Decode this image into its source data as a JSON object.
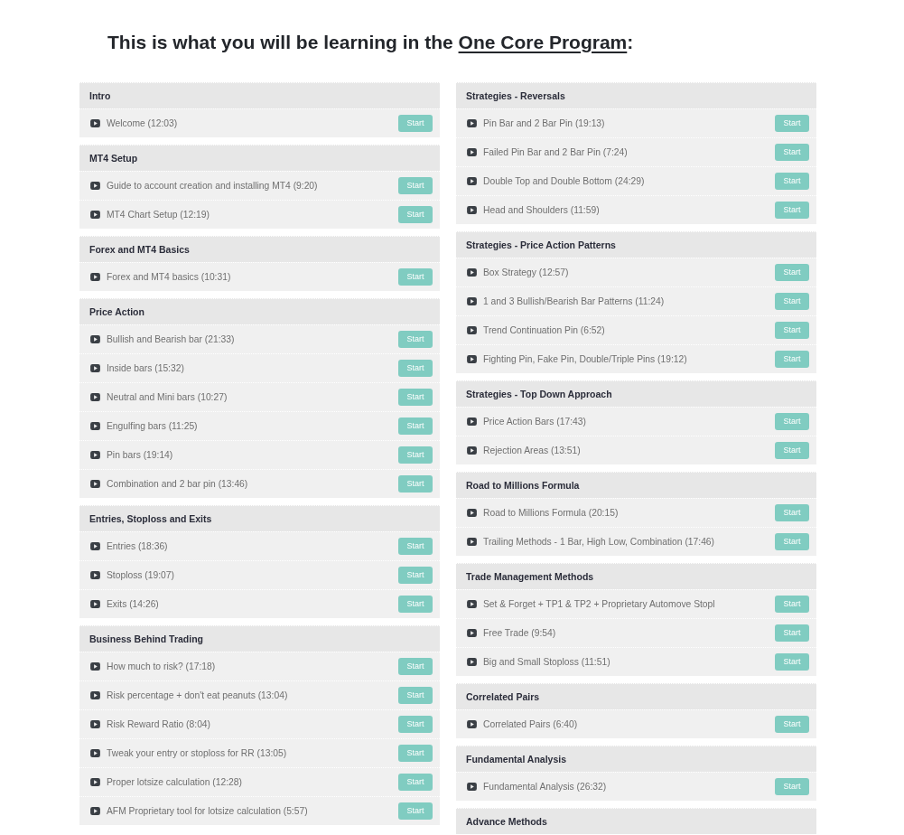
{
  "heading": {
    "text": "This is what you will be learning in the ",
    "link": "One Core Program",
    "suffix": ":"
  },
  "columns": [
    {
      "sections": [
        {
          "title": "Intro",
          "lessons": [
            {
              "title": "Welcome (12:03)",
              "button": "Start"
            }
          ]
        },
        {
          "title": "MT4 Setup",
          "lessons": [
            {
              "title": "Guide to account creation and installing MT4 (9:20)",
              "button": "Start"
            },
            {
              "title": "MT4 Chart Setup (12:19)",
              "button": "Start"
            }
          ]
        },
        {
          "title": "Forex and MT4 Basics",
          "lessons": [
            {
              "title": "Forex and MT4 basics (10:31)",
              "button": "Start"
            }
          ]
        },
        {
          "title": "Price Action",
          "lessons": [
            {
              "title": "Bullish and Bearish bar (21:33)",
              "button": "Start"
            },
            {
              "title": "Inside bars (15:32)",
              "button": "Start"
            },
            {
              "title": "Neutral and Mini bars (10:27)",
              "button": "Start"
            },
            {
              "title": "Engulfing bars (11:25)",
              "button": "Start"
            },
            {
              "title": "Pin bars (19:14)",
              "button": "Start"
            },
            {
              "title": "Combination and 2 bar pin (13:46)",
              "button": "Start"
            }
          ]
        },
        {
          "title": "Entries, Stoploss and Exits",
          "lessons": [
            {
              "title": "Entries (18:36)",
              "button": "Start"
            },
            {
              "title": "Stoploss (19:07)",
              "button": "Start"
            },
            {
              "title": "Exits (14:26)",
              "button": "Start"
            }
          ]
        },
        {
          "title": "Business Behind Trading",
          "lessons": [
            {
              "title": "How much to risk? (17:18)",
              "button": "Start"
            },
            {
              "title": "Risk percentage + don't eat peanuts (13:04)",
              "button": "Start"
            },
            {
              "title": "Risk Reward Ratio (8:04)",
              "button": "Start"
            },
            {
              "title": "Tweak your entry or stoploss for RR (13:05)",
              "button": "Start"
            },
            {
              "title": "Proper lotsize calculation (12:28)",
              "button": "Start"
            },
            {
              "title": "AFM Proprietary tool for lotsize calculation (5:57)",
              "button": "Start"
            }
          ]
        }
      ]
    },
    {
      "sections": [
        {
          "title": "Strategies - Reversals",
          "lessons": [
            {
              "title": "Pin Bar and 2 Bar Pin (19:13)",
              "button": "Start"
            },
            {
              "title": "Failed Pin Bar and 2 Bar Pin (7:24)",
              "button": "Start"
            },
            {
              "title": "Double Top and Double Bottom (24:29)",
              "button": "Start"
            },
            {
              "title": "Head and Shoulders (11:59)",
              "button": "Start"
            }
          ]
        },
        {
          "title": "Strategies - Price Action Patterns",
          "lessons": [
            {
              "title": "Box Strategy (12:57)",
              "button": "Start"
            },
            {
              "title": "1 and 3 Bullish/Bearish Bar Patterns (11:24)",
              "button": "Start"
            },
            {
              "title": "Trend Continuation Pin (6:52)",
              "button": "Start"
            },
            {
              "title": "Fighting Pin, Fake Pin, Double/Triple Pins (19:12)",
              "button": "Start"
            }
          ]
        },
        {
          "title": "Strategies - Top Down Approach",
          "lessons": [
            {
              "title": "Price Action Bars (17:43)",
              "button": "Start"
            },
            {
              "title": "Rejection Areas (13:51)",
              "button": "Start"
            }
          ]
        },
        {
          "title": "Road to Millions Formula",
          "lessons": [
            {
              "title": "Road to Millions Formula (20:15)",
              "button": "Start"
            },
            {
              "title": "Trailing Methods - 1 Bar, High Low, Combination (17:46)",
              "button": "Start"
            }
          ]
        },
        {
          "title": "Trade Management Methods",
          "lessons": [
            {
              "title": "Set & Forget + TP1 & TP2 + Proprietary Automove Stopl",
              "button": "Start"
            },
            {
              "title": "Free Trade (9:54)",
              "button": "Start"
            },
            {
              "title": "Big and Small Stoploss (11:51)",
              "button": "Start"
            }
          ]
        },
        {
          "title": "Correlated Pairs",
          "lessons": [
            {
              "title": "Correlated Pairs (6:40)",
              "button": "Start"
            }
          ]
        },
        {
          "title": "Fundamental Analysis",
          "lessons": [
            {
              "title": "Fundamental Analysis (26:32)",
              "button": "Start"
            }
          ]
        },
        {
          "title": "Advance Methods"
        }
      ]
    }
  ]
}
